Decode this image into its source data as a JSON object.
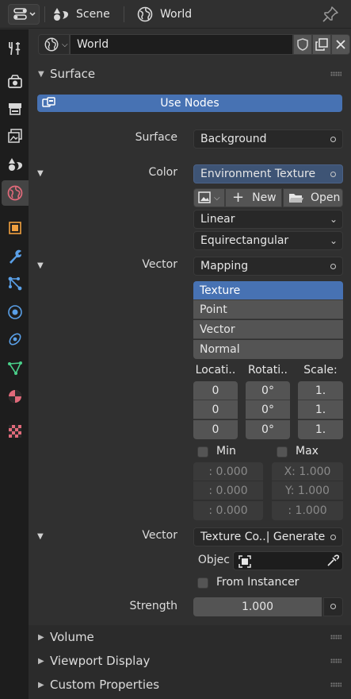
{
  "header": {
    "breadcrumb": [
      "Scene",
      "World"
    ]
  },
  "tabs": [
    {
      "name": "tool",
      "active": false
    },
    {
      "name": "render",
      "active": false
    },
    {
      "name": "output",
      "active": false
    },
    {
      "name": "view-layer",
      "active": false
    },
    {
      "name": "scene",
      "active": false
    },
    {
      "name": "world",
      "active": true
    },
    {
      "name": "object",
      "active": false
    },
    {
      "name": "modifiers",
      "active": false
    },
    {
      "name": "particles",
      "active": false
    },
    {
      "name": "physics",
      "active": false
    },
    {
      "name": "constraints",
      "active": false
    },
    {
      "name": "data",
      "active": false
    },
    {
      "name": "material",
      "active": false
    },
    {
      "name": "texture",
      "active": false
    }
  ],
  "world_selector": {
    "name": "World"
  },
  "surface": {
    "title": "Surface",
    "use_nodes_label": "Use Nodes",
    "surface_label": "Surface",
    "surface_value": "Background",
    "color_label": "Color",
    "color_value": "Environment Texture",
    "new_label": "New",
    "open_label": "Open",
    "interpolation": "Linear",
    "projection": "Equirectangular",
    "vector_label": "Vector",
    "vector_value": "Mapping",
    "mapping_types": [
      "Texture",
      "Point",
      "Vector",
      "Normal"
    ],
    "location_header": "Locati..",
    "rotation_header": "Rotati..",
    "scale_header": "Scale:",
    "location_values": [
      "0",
      "0",
      "0"
    ],
    "rotation_values": [
      "0°",
      "0°",
      "0°"
    ],
    "scale_values": [
      "1.",
      "1.",
      "1."
    ],
    "min_label": "Min",
    "max_label": "Max",
    "min_values": [
      ": 0.000",
      ": 0.000",
      ": 0.000"
    ],
    "max_values": [
      "X: 1.000",
      "Y: 1.000",
      ": 1.000"
    ],
    "vector2_label": "Vector",
    "vector2_value": "Texture Co..| Generate",
    "object_label": "Objec",
    "from_instancer_label": "From Instancer",
    "strength_label": "Strength",
    "strength_value": "1.000"
  },
  "collapsed_sections": [
    "Volume",
    "Viewport Display",
    "Custom Properties"
  ],
  "colors": {
    "accent": "#4772b3",
    "panel_bg": "#303030",
    "tab_bg": "#1d1d1d"
  }
}
